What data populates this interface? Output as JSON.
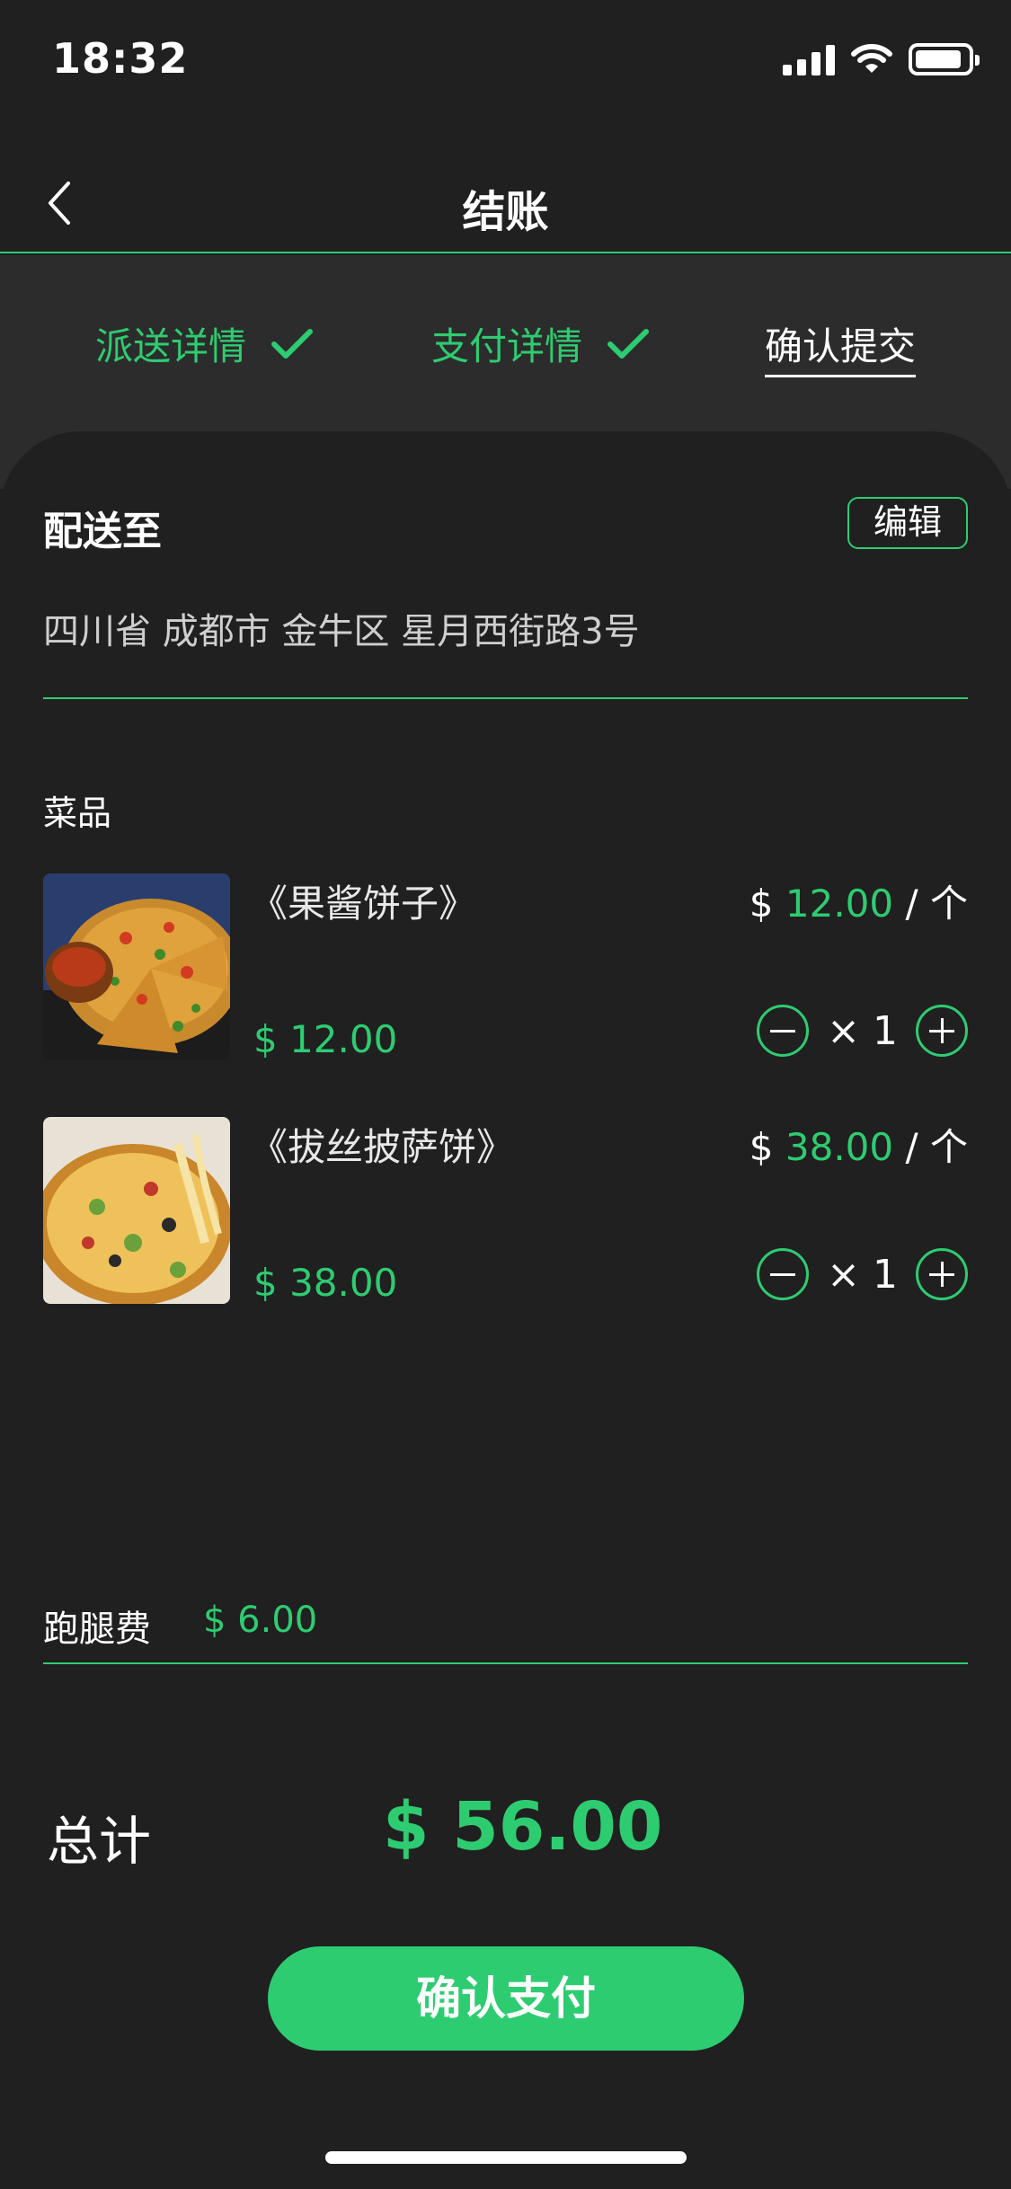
{
  "status_bar": {
    "time": "18:32",
    "icons": [
      "cellular-signal-icon",
      "wifi-icon",
      "battery-icon"
    ]
  },
  "nav": {
    "title": "结账",
    "back_icon": "chevron-left-icon"
  },
  "steps": [
    {
      "label": "派送详情",
      "state": "done"
    },
    {
      "label": "支付详情",
      "state": "done"
    },
    {
      "label": "确认提交",
      "state": "current"
    }
  ],
  "shipping": {
    "label": "配送至",
    "edit_label": "编辑",
    "address": "四川省 成都市 金牛区 星月西街路3号"
  },
  "dishes": {
    "label": "菜品",
    "items": [
      {
        "name": "《果酱饼子》",
        "price": "$ 12.00",
        "unit_currency": "$",
        "unit_amount": "12.00",
        "unit_suffix": "/ 个",
        "qty": "× 1"
      },
      {
        "name": "《拔丝披萨饼》",
        "price": "$ 38.00",
        "unit_currency": "$",
        "unit_amount": "38.00",
        "unit_suffix": "/ 个",
        "qty": "× 1"
      }
    ]
  },
  "delivery": {
    "label": "跑腿费",
    "fee": "$ 6.00"
  },
  "total": {
    "label": "总计",
    "value": "$ 56.00"
  },
  "pay_button": "确认支付",
  "colors": {
    "accent": "#2ecc71",
    "background": "#202020",
    "band": "#2c2c2c"
  }
}
